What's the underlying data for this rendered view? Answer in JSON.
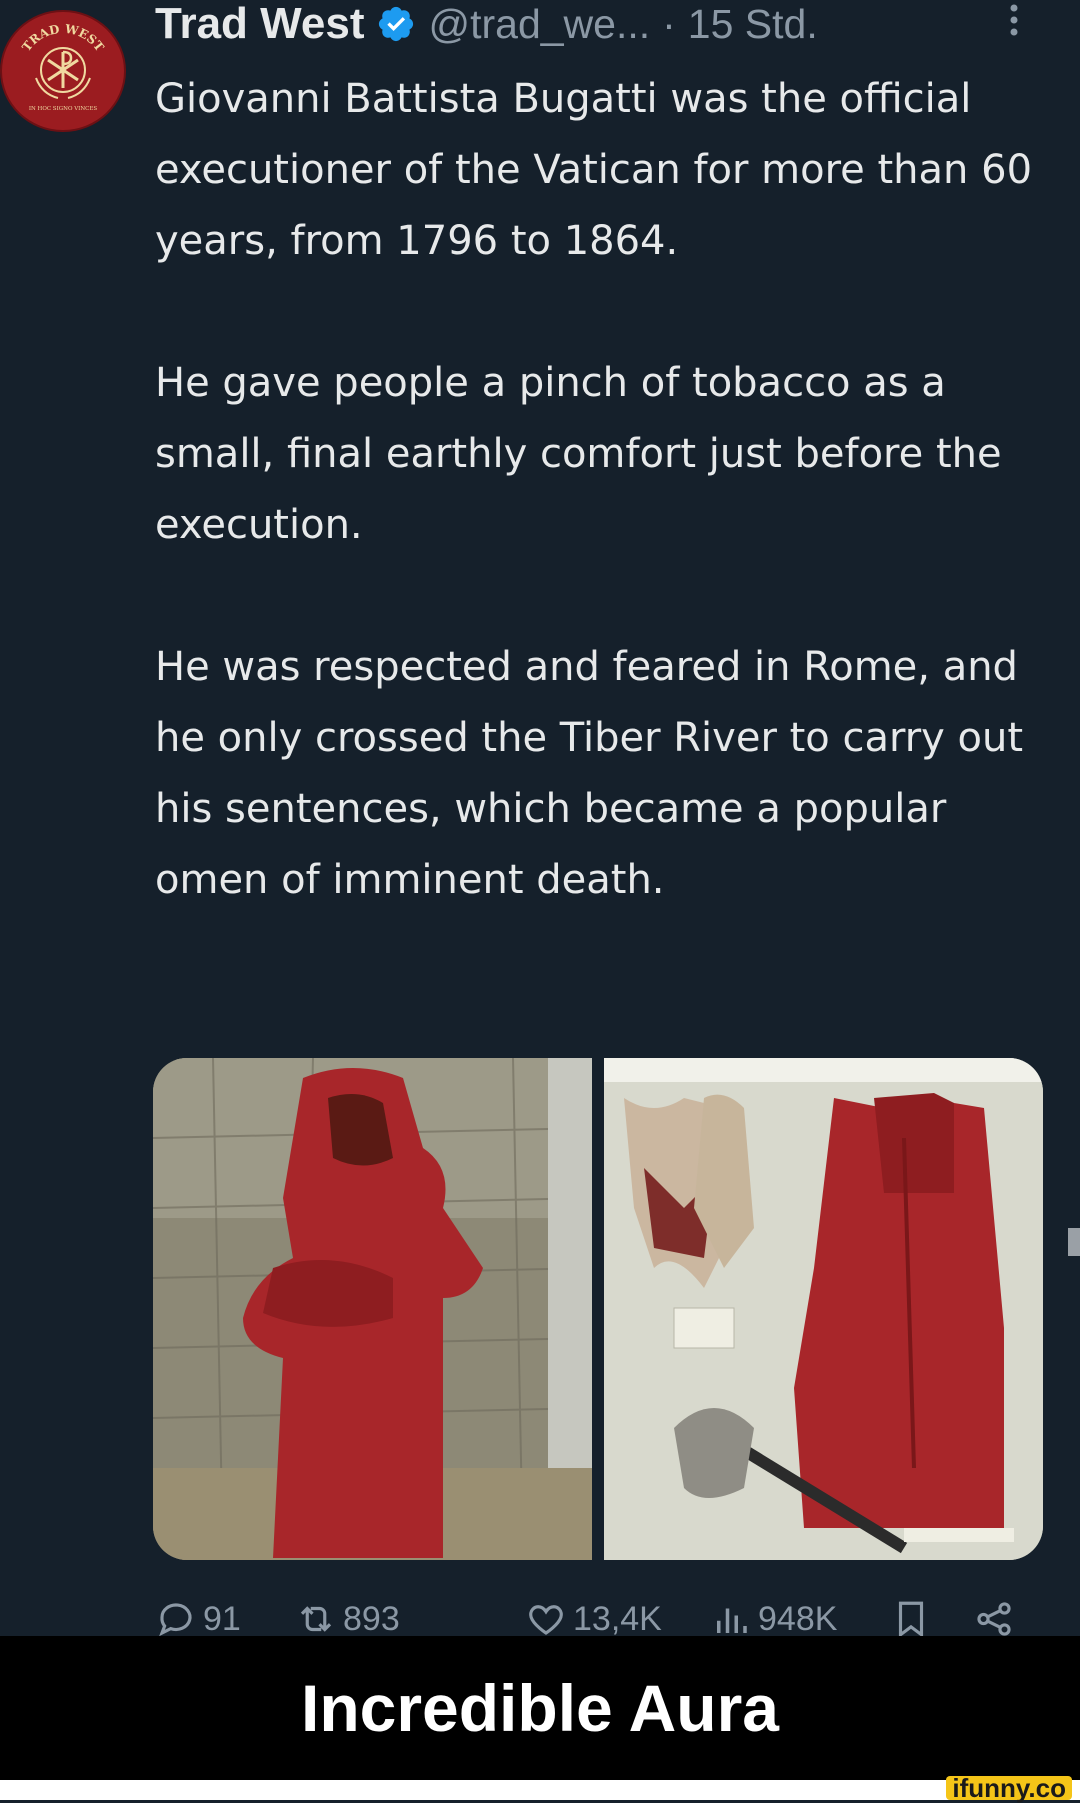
{
  "tweet": {
    "author_name": "Trad West",
    "handle": "@trad_we...",
    "separator": "·",
    "time": "15 Std.",
    "more_icon": "more-vertical-icon",
    "verified_icon": "verified-badge-icon",
    "avatar": {
      "top_text": "TRAD WEST",
      "bottom_text": "IN HOC SIGNO VINCES",
      "color": "#9b1c20"
    },
    "paragraphs": [
      "Giovanni Battista Bugatti was the official executioner of the Vatican for more than 60 years, from 1796 to 1864.",
      "He gave people a pinch of tobacco as a small, final earthly comfort just before the execution.",
      "He was respected and feared in Rome, and he only crossed the Tiber River to carry out his sentences, which became a popular omen of imminent death."
    ],
    "actions": {
      "replies": "91",
      "retweets": "893",
      "likes": "13,4K",
      "views": "948K"
    }
  },
  "meme_caption": "Incredible Aura",
  "watermark": "ifunny.co",
  "colors": {
    "background": "#15202b",
    "text": "#e7e9ea",
    "muted": "#8b98a5",
    "verified": "#1d9bf0",
    "robe_red": "#a8262a"
  }
}
